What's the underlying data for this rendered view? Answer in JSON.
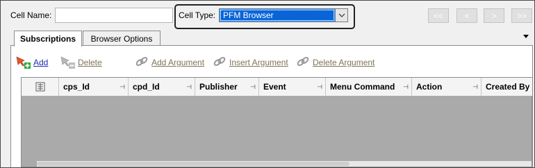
{
  "top": {
    "cell_name_label": "Cell Name:",
    "cell_name_value": "",
    "cell_type_label": "Cell Type:",
    "cell_type_value": "PFM Browser",
    "nav": [
      "<<",
      "<",
      ">",
      ">>"
    ]
  },
  "tabs": [
    {
      "label": "Subscriptions",
      "active": true
    },
    {
      "label": "Browser Options",
      "active": false
    }
  ],
  "toolbar": {
    "add": "Add",
    "delete": "Delete",
    "add_argument": "Add Argument",
    "insert_argument": "Insert Argument",
    "delete_argument": "Delete Argument"
  },
  "grid": {
    "columns": [
      "cps_Id",
      "cpd_Id",
      "Publisher",
      "Event",
      "Menu Command",
      "Action",
      "Created By"
    ]
  },
  "colors": {
    "selection": "#0a64d8",
    "link_enabled": "#1a2fb0",
    "link_disabled": "#7f7356",
    "grid_empty": "#aaaaaa"
  }
}
